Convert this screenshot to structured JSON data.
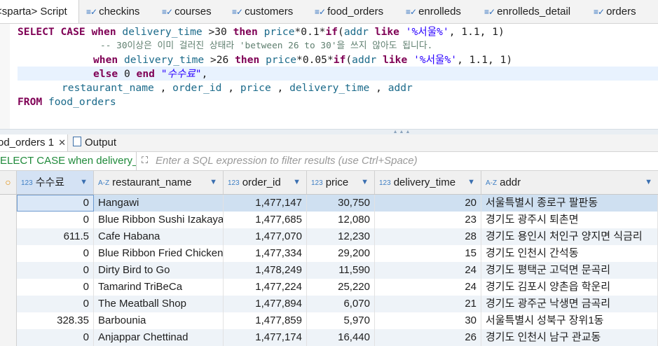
{
  "editor_tabs": [
    {
      "label": "<sparta> Script",
      "icon": "script-icon",
      "active": true
    },
    {
      "label": "checkins",
      "icon": "table-icon"
    },
    {
      "label": "courses",
      "icon": "table-icon"
    },
    {
      "label": "customers",
      "icon": "table-icon"
    },
    {
      "label": "food_orders",
      "icon": "table-icon"
    },
    {
      "label": "enrolleds",
      "icon": "table-icon"
    },
    {
      "label": "enrolleds_detail",
      "icon": "table-icon"
    },
    {
      "label": "orders",
      "icon": "table-icon"
    }
  ],
  "sql": {
    "l1": {
      "k1": "SELECT",
      "k2": "CASE",
      "k3": "when",
      "c1": "delivery_time",
      "o1": " >",
      "n1": "30",
      "k4": "then",
      "c2": "price",
      "o2": "*",
      "n2": "0.1",
      "o3": "*",
      "k5": "if",
      "o4": "(",
      "c3": "addr",
      "k6": "like",
      "s1": "'%서울%'",
      "o5": ", ",
      "n3": "1.1",
      "o6": ", ",
      "n4": "1",
      "o7": ")"
    },
    "comment": "-- 30이상은 이미 걸러진 상태라 'between 26 to 30'을 쓰지 않아도 됩니다.",
    "l3": {
      "k1": "when",
      "c1": "delivery_time",
      "o1": " >",
      "n1": "26",
      "k2": "then",
      "c2": "price",
      "o2": "*",
      "n2": "0.05",
      "o3": "*",
      "k3": "if",
      "o4": "(",
      "c3": "addr",
      "k4": "like",
      "s1": "'%서울%'",
      "o5": ", ",
      "n3": "1.1",
      "o6": ", ",
      "n4": "1",
      "o7": ")"
    },
    "l4": {
      "k1": "else",
      "n1": "0",
      "k2": "end",
      "a1": "\"수수료\"",
      "o1": ","
    },
    "l5": {
      "c1": "restaurant_name",
      "o1": " , ",
      "c2": "order_id",
      "o2": " , ",
      "c3": "price",
      "o3": " , ",
      "c4": "delivery_time",
      "o4": " , ",
      "c5": "addr"
    },
    "l6": {
      "k1": "FROM",
      "t1": "food_orders"
    }
  },
  "result_tabs": [
    {
      "label": "od_orders 1",
      "active": true
    },
    {
      "label": "Output"
    }
  ],
  "filter": {
    "query_preview": "ELECT CASE when delivery_tim",
    "placeholder": "Enter a SQL expression to filter results (use Ctrl+Space)"
  },
  "grid": {
    "columns": [
      {
        "label": "수수료",
        "type": "123"
      },
      {
        "label": "restaurant_name",
        "type": "A-Z"
      },
      {
        "label": "order_id",
        "type": "123"
      },
      {
        "label": "price",
        "type": "123"
      },
      {
        "label": "delivery_time",
        "type": "123"
      },
      {
        "label": "addr",
        "type": "A-Z"
      }
    ],
    "rows": [
      [
        "0",
        "Hangawi",
        "1,477,147",
        "30,750",
        "20",
        "서울특별시 종로구 팔판동"
      ],
      [
        "0",
        "Blue Ribbon Sushi Izakaya",
        "1,477,685",
        "12,080",
        "23",
        "경기도 광주시 퇴촌면"
      ],
      [
        "611.5",
        "Cafe Habana",
        "1,477,070",
        "12,230",
        "28",
        "경기도 용인시 처인구 양지면 식금리"
      ],
      [
        "0",
        "Blue Ribbon Fried Chicken",
        "1,477,334",
        "29,200",
        "15",
        "경기도 인천시 간석동"
      ],
      [
        "0",
        "Dirty Bird to Go",
        "1,478,249",
        "11,590",
        "24",
        "경기도 평택군 고덕면 문곡리"
      ],
      [
        "0",
        "Tamarind TriBeCa",
        "1,477,224",
        "25,220",
        "24",
        "경기도 김포시 양촌읍 학운리"
      ],
      [
        "0",
        "The Meatball Shop",
        "1,477,894",
        "6,070",
        "21",
        "경기도 광주군 낙생면 금곡리"
      ],
      [
        "328.35",
        "Barbounia",
        "1,477,859",
        "5,970",
        "30",
        "서울특별시 성북구 장위1동"
      ],
      [
        "0",
        "Anjappar Chettinad",
        "1,477,174",
        "16,440",
        "26",
        "경기도 인천시 남구 관교동"
      ]
    ]
  }
}
